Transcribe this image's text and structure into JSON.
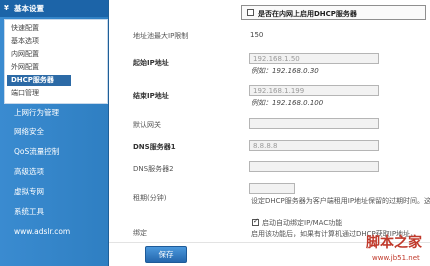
{
  "sidebar": {
    "section_header": "基本设置",
    "sub_items": [
      {
        "label": "快速配置"
      },
      {
        "label": "基本选项"
      },
      {
        "label": "内网配置"
      },
      {
        "label": "外网配置"
      },
      {
        "label": "DHCP服务器",
        "active": true
      },
      {
        "label": "端口管理"
      }
    ],
    "menu_items": [
      {
        "label": "上网行为管理"
      },
      {
        "label": "网络安全"
      },
      {
        "label": "QoS流量控制"
      },
      {
        "label": "高级选项"
      },
      {
        "label": "虚拟专网"
      },
      {
        "label": "系统工具"
      },
      {
        "label": "www.adslr.com"
      }
    ]
  },
  "dhcp": {
    "enable_label": "是否在内网上启用DHCP服务器",
    "enable_checked": false,
    "pool_max_label": "地址池最大IP限制",
    "pool_max_value": "150",
    "start_ip_label": "起始IP地址",
    "start_ip_value": "192.168.1.50",
    "start_ip_example": "例如：192.168.0.30",
    "end_ip_label": "结束IP地址",
    "end_ip_value": "192.168.1.199",
    "end_ip_example": "例如：192.168.0.100",
    "gateway_label": "默认网关",
    "gateway_value": "",
    "dns1_label": "DNS服务器1",
    "dns1_value": "8.8.8.8",
    "dns2_label": "DNS服务器2",
    "dns2_value": "",
    "lease_label": "租期(分钟)",
    "lease_value": "",
    "lease_desc": "设定DHCP服务器为客户端租用IP地址保留的过期时间。这",
    "bind_label": "绑定",
    "bind_checkbox_label": "启动自动绑定IP/MAC功能",
    "bind_checked": true,
    "bind_desc": "启用该功能后，如果有计算机通过DHCP获取IP地址，"
  },
  "actions": {
    "save_label": "保存"
  },
  "watermark": {
    "logo": "脚本之家",
    "url": "www.jb51.net"
  },
  "colors": {
    "sidebar_bg": "#2f7fc2",
    "active_item_bg": "#2c6aa6",
    "button_bg": "#2d7cc4",
    "watermark_red": "#c0392b"
  }
}
